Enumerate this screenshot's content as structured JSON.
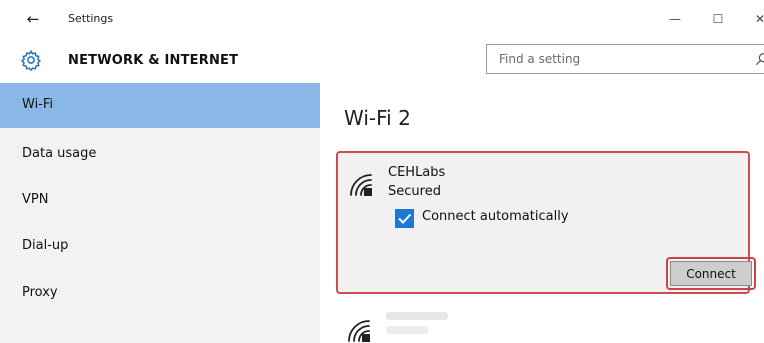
{
  "window": {
    "title": "Settings",
    "back_icon": "back-arrow-icon",
    "controls": {
      "minimize": "—",
      "maximize": "☐",
      "close": "✕"
    }
  },
  "header": {
    "icon": "gear-icon",
    "title": "NETWORK & INTERNET",
    "search": {
      "placeholder": "Find a setting",
      "icon": "search-icon"
    }
  },
  "sidebar": {
    "items": [
      {
        "label": "Wi-Fi",
        "selected": true
      },
      {
        "label": "Data usage",
        "selected": false
      },
      {
        "label": "VPN",
        "selected": false
      },
      {
        "label": "Dial-up",
        "selected": false
      },
      {
        "label": "Proxy",
        "selected": false
      }
    ]
  },
  "main": {
    "title": "Wi-Fi 2",
    "networks": [
      {
        "ssid": "CEHLabs",
        "security": "Secured",
        "icon": "wifi-secured-icon",
        "auto_connect_label": "Connect automatically",
        "auto_connect_checked": true,
        "connect_label": "Connect"
      }
    ]
  },
  "colors": {
    "selected_item": "#8ab8e6",
    "checkbox": "#1e78d2",
    "highlight_border": "#d04c55",
    "sidebar_bg": "#f2f2f2",
    "card_bg": "#f1f1f1"
  }
}
